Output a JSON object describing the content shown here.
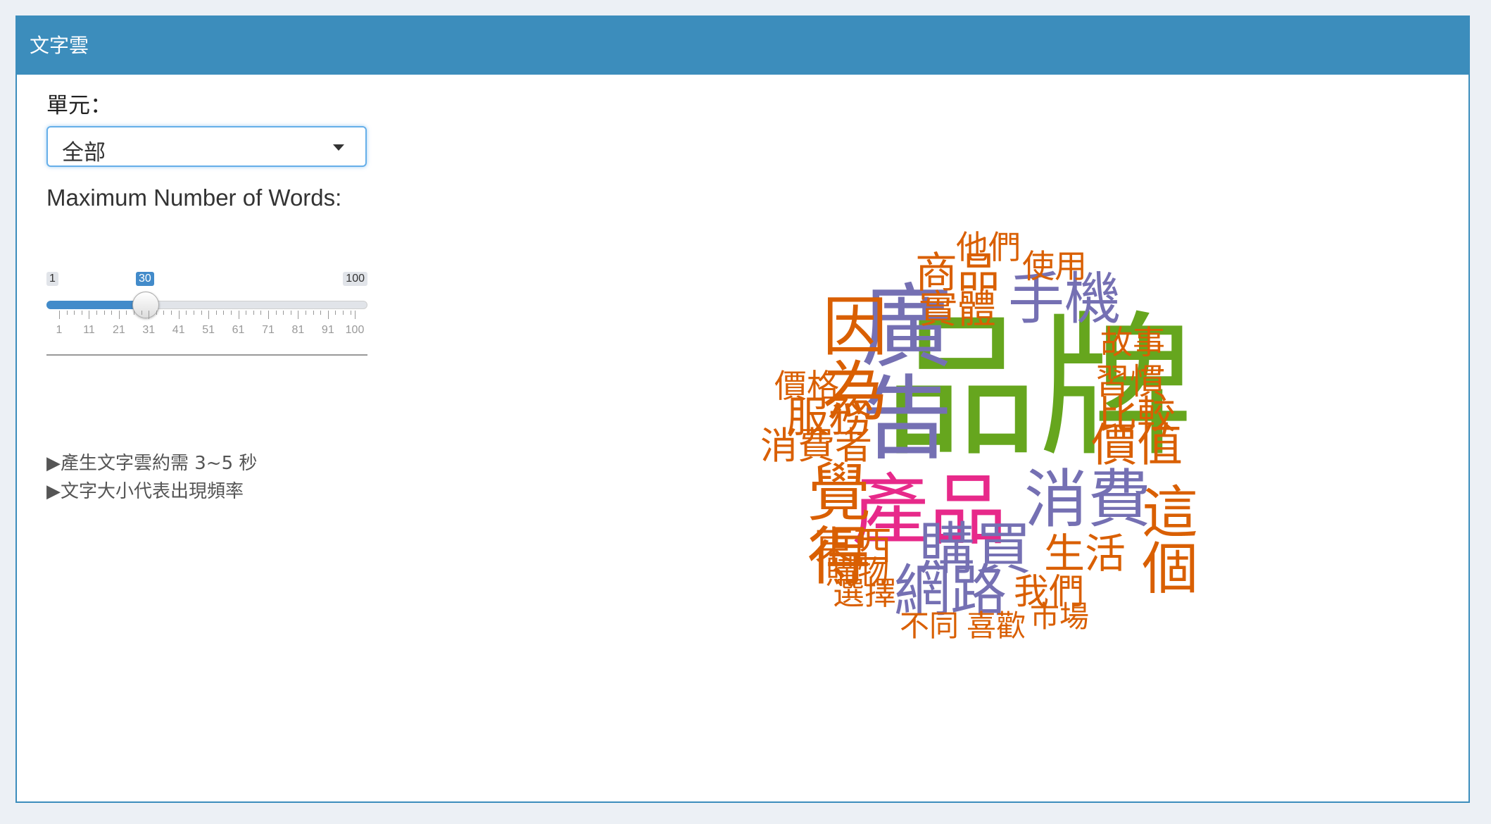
{
  "box": {
    "title": "文字雲"
  },
  "controls": {
    "unit_label": "單元：",
    "unit_select": {
      "selected": "全部"
    },
    "max_words": {
      "label": "Maximum Number of Words:",
      "min": 1,
      "max": 100,
      "value": 30,
      "min_label": "1",
      "max_label": "100",
      "value_label": "30",
      "ticks": [
        "1",
        "11",
        "21",
        "31",
        "41",
        "51",
        "61",
        "71",
        "81",
        "91",
        "100"
      ]
    }
  },
  "notes": [
    "▶產生文字雲約需 3~5 秒",
    "▶文字大小代表出現頻率"
  ],
  "colors": {
    "header": "#3c8dbc",
    "orange": "#d95f02",
    "purple": "#7570b3",
    "green": "#66a61e",
    "pink": "#e7298a",
    "slider_fill": "#428bca"
  },
  "wordcloud": {
    "words": [
      {
        "text": "品牌",
        "color": "green"
      },
      {
        "text": "產品",
        "color": "pink"
      },
      {
        "text": "消費",
        "color": "purple"
      },
      {
        "text": "購買",
        "color": "purple"
      },
      {
        "text": "網路",
        "color": "purple"
      },
      {
        "text": "手機",
        "color": "purple"
      },
      {
        "text": "廣告",
        "color": "purple"
      },
      {
        "text": "商品",
        "color": "orange"
      },
      {
        "text": "實體",
        "color": "orange"
      },
      {
        "text": "他們",
        "color": "orange"
      },
      {
        "text": "使用",
        "color": "orange"
      },
      {
        "text": "因為",
        "color": "orange"
      },
      {
        "text": "故事",
        "color": "orange"
      },
      {
        "text": "習慣",
        "color": "orange"
      },
      {
        "text": "比較",
        "color": "orange"
      },
      {
        "text": "價值",
        "color": "orange"
      },
      {
        "text": "價格",
        "color": "orange"
      },
      {
        "text": "服務",
        "color": "orange"
      },
      {
        "text": "消費者",
        "color": "orange"
      },
      {
        "text": "覺得",
        "color": "orange"
      },
      {
        "text": "這個",
        "color": "orange"
      },
      {
        "text": "生活",
        "color": "orange"
      },
      {
        "text": "東西",
        "color": "orange"
      },
      {
        "text": "購物",
        "color": "orange"
      },
      {
        "text": "選擇",
        "color": "orange"
      },
      {
        "text": "我們",
        "color": "orange"
      },
      {
        "text": "不同",
        "color": "orange"
      },
      {
        "text": "喜歡",
        "color": "orange"
      },
      {
        "text": "市場",
        "color": "orange"
      }
    ]
  }
}
